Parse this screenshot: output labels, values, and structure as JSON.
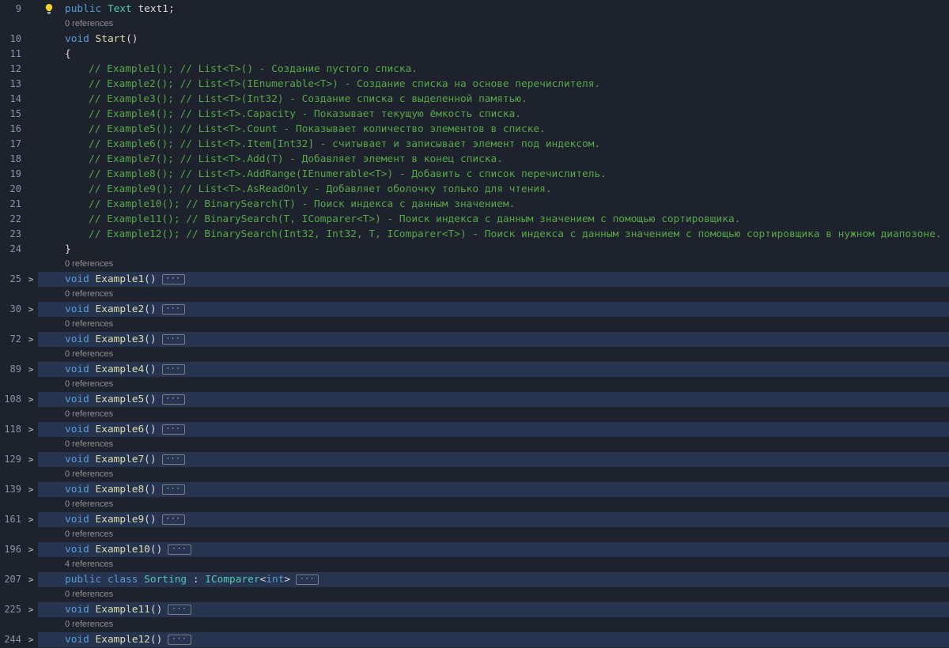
{
  "colors": {
    "bg": "#1e222c",
    "band": "#273450",
    "gutter": "#8696a7",
    "lens": "#8f8f8f",
    "keyword": "#569cd6",
    "type": "#4ec9b0",
    "method": "#dcdcaa",
    "plain": "#dcdcdc",
    "comment": "#57a64a",
    "chevron": "#c5ccd6",
    "bulb": "#f6d32d"
  },
  "glyphs": {
    "chevron": ">",
    "collapsed": "···"
  },
  "rows": [
    {
      "kind": "code",
      "line": "9",
      "bulb": true,
      "indent": 1,
      "tokens": [
        {
          "text": "public ",
          "style": "keyword"
        },
        {
          "text": "Text",
          "style": "type"
        },
        {
          "text": " text1;",
          "style": "plain"
        }
      ]
    },
    {
      "kind": "lens",
      "indent": 1,
      "text": "0 references"
    },
    {
      "kind": "code",
      "line": "10",
      "indent": 1,
      "tokens": [
        {
          "text": "void ",
          "style": "keyword"
        },
        {
          "text": "Start",
          "style": "method"
        },
        {
          "text": "()",
          "style": "plain"
        }
      ]
    },
    {
      "kind": "code",
      "line": "11",
      "indent": 1,
      "tokens": [
        {
          "text": "{",
          "style": "plain"
        }
      ]
    },
    {
      "kind": "code",
      "line": "12",
      "indent": 2,
      "tokens": [
        {
          "text": "// Example1(); // List<T>() - Создание пустого списка.",
          "style": "comment"
        }
      ]
    },
    {
      "kind": "code",
      "line": "13",
      "indent": 2,
      "tokens": [
        {
          "text": "// Example2(); // List<T>(IEnumerable<T>) - Создание списка на основе перечислителя.",
          "style": "comment"
        }
      ]
    },
    {
      "kind": "code",
      "line": "14",
      "indent": 2,
      "tokens": [
        {
          "text": "// Example3(); // List<T>(Int32) - Создание списка с выделенной памятью.",
          "style": "comment"
        }
      ]
    },
    {
      "kind": "code",
      "line": "15",
      "indent": 2,
      "tokens": [
        {
          "text": "// Example4(); // List<T>.Capacity - Показывает текущую ёмкость списка.",
          "style": "comment"
        }
      ]
    },
    {
      "kind": "code",
      "line": "16",
      "indent": 2,
      "tokens": [
        {
          "text": "// Example5(); // List<T>.Count - Показывает количество элементов в списке.",
          "style": "comment"
        }
      ]
    },
    {
      "kind": "code",
      "line": "17",
      "indent": 2,
      "tokens": [
        {
          "text": "// Example6(); // List<T>.Item[Int32] - считывает и записывает элемент под индексом.",
          "style": "comment"
        }
      ]
    },
    {
      "kind": "code",
      "line": "18",
      "indent": 2,
      "tokens": [
        {
          "text": "// Example7(); // List<T>.Add(T) - Добавляет элемент в конец списка.",
          "style": "comment"
        }
      ]
    },
    {
      "kind": "code",
      "line": "19",
      "indent": 2,
      "tokens": [
        {
          "text": "// Example8(); // List<T>.AddRange(IEnumerable<T>) - Добавить с список перечислитель.",
          "style": "comment"
        }
      ]
    },
    {
      "kind": "code",
      "line": "20",
      "indent": 2,
      "tokens": [
        {
          "text": "// Example9(); // List<T>.AsReadOnly - Добавляет оболочку только для чтения.",
          "style": "comment"
        }
      ]
    },
    {
      "kind": "code",
      "line": "21",
      "indent": 2,
      "tokens": [
        {
          "text": "// Example10(); // BinarySearch(T) - Поиск индекса с данным значением.",
          "style": "comment"
        }
      ]
    },
    {
      "kind": "code",
      "line": "22",
      "indent": 2,
      "tokens": [
        {
          "text": "// Example11(); // BinarySearch(T, IComparer<T>) - Поиск индекса с данным значением с помощью сортировщика.",
          "style": "comment"
        }
      ]
    },
    {
      "kind": "code",
      "line": "23",
      "indent": 2,
      "tokens": [
        {
          "text": "// Example12(); // BinarySearch(Int32, Int32, T, IComparer<T>) - Поиск индекса с данным значением с помощью сортировщика в нужном диапозоне.",
          "style": "comment"
        }
      ]
    },
    {
      "kind": "code",
      "line": "24",
      "indent": 1,
      "tokens": [
        {
          "text": "}",
          "style": "plain"
        }
      ]
    },
    {
      "kind": "lens",
      "indent": 1,
      "text": "0 references"
    },
    {
      "kind": "code",
      "line": "25",
      "chevron": true,
      "highlight": true,
      "collapsed": true,
      "indent": 1,
      "tokens": [
        {
          "text": "void ",
          "style": "keyword"
        },
        {
          "text": "Example1",
          "style": "method"
        },
        {
          "text": "()",
          "style": "plain"
        }
      ]
    },
    {
      "kind": "lens",
      "indent": 1,
      "text": "0 references"
    },
    {
      "kind": "code",
      "line": "30",
      "chevron": true,
      "highlight": true,
      "collapsed": true,
      "indent": 1,
      "tokens": [
        {
          "text": "void ",
          "style": "keyword"
        },
        {
          "text": "Example2",
          "style": "method"
        },
        {
          "text": "()",
          "style": "plain"
        }
      ]
    },
    {
      "kind": "lens",
      "indent": 1,
      "text": "0 references"
    },
    {
      "kind": "code",
      "line": "72",
      "chevron": true,
      "highlight": true,
      "collapsed": true,
      "indent": 1,
      "tokens": [
        {
          "text": "void ",
          "style": "keyword"
        },
        {
          "text": "Example3",
          "style": "method"
        },
        {
          "text": "()",
          "style": "plain"
        }
      ]
    },
    {
      "kind": "lens",
      "indent": 1,
      "text": "0 references"
    },
    {
      "kind": "code",
      "line": "89",
      "chevron": true,
      "highlight": true,
      "collapsed": true,
      "indent": 1,
      "tokens": [
        {
          "text": "void ",
          "style": "keyword"
        },
        {
          "text": "Example4",
          "style": "method"
        },
        {
          "text": "()",
          "style": "plain"
        }
      ]
    },
    {
      "kind": "lens",
      "indent": 1,
      "text": "0 references"
    },
    {
      "kind": "code",
      "line": "108",
      "chevron": true,
      "highlight": true,
      "collapsed": true,
      "indent": 1,
      "tokens": [
        {
          "text": "void ",
          "style": "keyword"
        },
        {
          "text": "Example5",
          "style": "method"
        },
        {
          "text": "()",
          "style": "plain"
        }
      ]
    },
    {
      "kind": "lens",
      "indent": 1,
      "text": "0 references"
    },
    {
      "kind": "code",
      "line": "118",
      "chevron": true,
      "highlight": true,
      "collapsed": true,
      "indent": 1,
      "tokens": [
        {
          "text": "void ",
          "style": "keyword"
        },
        {
          "text": "Example6",
          "style": "method"
        },
        {
          "text": "()",
          "style": "plain"
        }
      ]
    },
    {
      "kind": "lens",
      "indent": 1,
      "text": "0 references"
    },
    {
      "kind": "code",
      "line": "129",
      "chevron": true,
      "highlight": true,
      "collapsed": true,
      "indent": 1,
      "tokens": [
        {
          "text": "void ",
          "style": "keyword"
        },
        {
          "text": "Example7",
          "style": "method"
        },
        {
          "text": "()",
          "style": "plain"
        }
      ]
    },
    {
      "kind": "lens",
      "indent": 1,
      "text": "0 references"
    },
    {
      "kind": "code",
      "line": "139",
      "chevron": true,
      "highlight": true,
      "collapsed": true,
      "indent": 1,
      "tokens": [
        {
          "text": "void ",
          "style": "keyword"
        },
        {
          "text": "Example8",
          "style": "method"
        },
        {
          "text": "()",
          "style": "plain"
        }
      ]
    },
    {
      "kind": "lens",
      "indent": 1,
      "text": "0 references"
    },
    {
      "kind": "code",
      "line": "161",
      "chevron": true,
      "highlight": true,
      "collapsed": true,
      "indent": 1,
      "tokens": [
        {
          "text": "void ",
          "style": "keyword"
        },
        {
          "text": "Example9",
          "style": "method"
        },
        {
          "text": "()",
          "style": "plain"
        }
      ]
    },
    {
      "kind": "lens",
      "indent": 1,
      "text": "0 references"
    },
    {
      "kind": "code",
      "line": "196",
      "chevron": true,
      "highlight": true,
      "collapsed": true,
      "indent": 1,
      "tokens": [
        {
          "text": "void ",
          "style": "keyword"
        },
        {
          "text": "Example10",
          "style": "method"
        },
        {
          "text": "()",
          "style": "plain"
        }
      ]
    },
    {
      "kind": "lens",
      "indent": 1,
      "text": "4 references"
    },
    {
      "kind": "code",
      "line": "207",
      "chevron": true,
      "highlight": true,
      "collapsed": true,
      "indent": 1,
      "tokens": [
        {
          "text": "public class ",
          "style": "keyword"
        },
        {
          "text": "Sorting",
          "style": "type"
        },
        {
          "text": " : ",
          "style": "plain"
        },
        {
          "text": "IComparer",
          "style": "type"
        },
        {
          "text": "<",
          "style": "plain"
        },
        {
          "text": "int",
          "style": "keyword"
        },
        {
          "text": ">",
          "style": "plain"
        }
      ]
    },
    {
      "kind": "lens",
      "indent": 1,
      "text": "0 references"
    },
    {
      "kind": "code",
      "line": "225",
      "chevron": true,
      "highlight": true,
      "collapsed": true,
      "indent": 1,
      "tokens": [
        {
          "text": "void ",
          "style": "keyword"
        },
        {
          "text": "Example11",
          "style": "method"
        },
        {
          "text": "()",
          "style": "plain"
        }
      ]
    },
    {
      "kind": "lens",
      "indent": 1,
      "text": "0 references"
    },
    {
      "kind": "code",
      "line": "244",
      "chevron": true,
      "highlight": true,
      "collapsed": true,
      "indent": 1,
      "tokens": [
        {
          "text": "void ",
          "style": "keyword"
        },
        {
          "text": "Example12",
          "style": "method"
        },
        {
          "text": "()",
          "style": "plain"
        }
      ]
    }
  ]
}
